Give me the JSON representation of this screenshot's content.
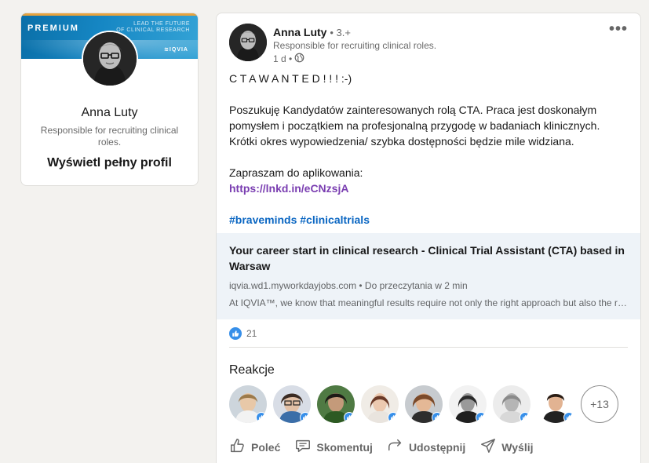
{
  "profile": {
    "premium_label": "PREMIUM",
    "banner_tagline_1": "LEAD THE FUTURE",
    "banner_tagline_2": "OF CLINICAL RESEARCH",
    "banner_brand": "≋IQVIA",
    "name": "Anna Luty",
    "headline": "Responsible for recruiting clinical roles.",
    "view_profile": "Wyświetl pełny profil"
  },
  "post": {
    "author": "Anna Luty",
    "degree": "• 3.+",
    "headline": "Responsible for recruiting clinical roles.",
    "time": "1 d •",
    "visibility_icon": "globe-icon",
    "more_icon": "•••",
    "body": {
      "line1": "C T A W A N T E D ! ! ! :-)",
      "para2_l1": "Poszukuję Kandydatów zainteresowanych rolą CTA. Praca jest doskonałym",
      "para2_l2": "pomysłem i początkiem na profesjonalną przygodę w badaniach klinicznych.",
      "para2_l3": "Krótki okres wypowiedzenia/ szybka dostępności będzie mile widziana.",
      "invite": "Zapraszam do aplikowania:",
      "link": "https://lnkd.in/eCNzsjA",
      "hashtags": "#braveminds #clinicaltrials"
    },
    "preview": {
      "title_l1": "Your career start in clinical research - Clinical Trial Assistant (CTA) based in",
      "title_l2": "Warsaw",
      "source": "iqvia.wd1.myworkdayjobs.com • Do przeczytania w 2 min",
      "description": "At IQVIA™, we know that meaningful results require not only the right approach but also the right people."
    },
    "reaction_count": "21",
    "reactions_label": "Reakcje",
    "more_reactors": "+13",
    "actions": {
      "recommend": "Poleć",
      "comment": "Skomentuj",
      "share": "Udostępnij",
      "send": "Wyślij"
    }
  },
  "colors": {
    "link_blue": "#0a66c2",
    "link_visited": "#7a3eb1",
    "like_blue": "#378fe9",
    "background": "#f3f2ef"
  }
}
